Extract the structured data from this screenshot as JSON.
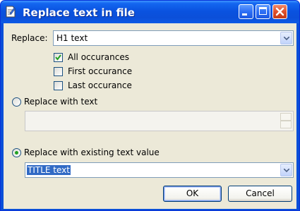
{
  "window": {
    "title": "Replace text in file"
  },
  "replace": {
    "label": "Replace:",
    "value": "H1 text",
    "options": [
      {
        "label": "All occurances",
        "checked": true
      },
      {
        "label": "First occurance",
        "checked": false
      },
      {
        "label": "Last occurance",
        "checked": false
      }
    ]
  },
  "with_text": {
    "label": "Replace with text",
    "selected": false,
    "value": ""
  },
  "with_existing": {
    "label": "Replace with existing text value",
    "selected": true,
    "value": "TITLE text"
  },
  "buttons": {
    "ok": "OK",
    "cancel": "Cancel"
  },
  "colors": {
    "title_bar": "#0a53e0",
    "dialog_bg": "#ece9d8",
    "selection": "#316ac5",
    "radio_dot": "#21a121"
  }
}
